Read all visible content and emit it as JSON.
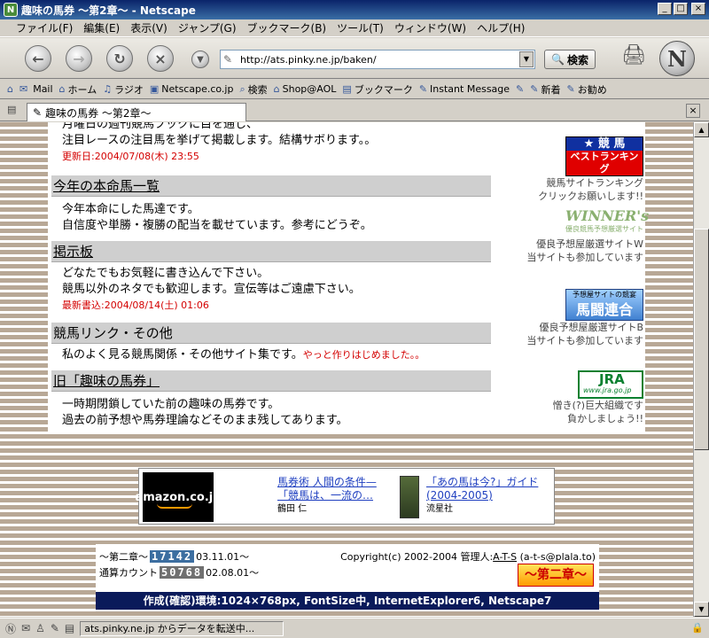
{
  "window": {
    "title": "趣味の馬券 〜第2章〜 - Netscape",
    "min": "_",
    "max": "□",
    "close": "×"
  },
  "menu": [
    "ファイル(F)",
    "編集(E)",
    "表示(V)",
    "ジャンプ(G)",
    "ブックマーク(B)",
    "ツール(T)",
    "ウィンドウ(W)",
    "ヘルプ(H)"
  ],
  "nav": {
    "url": "http://ats.pinky.ne.jp/baken/",
    "search_label": "検索"
  },
  "bookmarks": [
    {
      "label": "Mail",
      "icon": "mail-icon"
    },
    {
      "label": "ホーム",
      "icon": "home-icon"
    },
    {
      "label": "ラジオ",
      "icon": "headphones-icon"
    },
    {
      "label": "Netscape.co.jp",
      "icon": "my-icon"
    },
    {
      "label": "検索",
      "icon": "search-icon"
    },
    {
      "label": "Shop@AOL",
      "icon": "shop-icon"
    },
    {
      "label": "ブックマーク",
      "icon": "folder-icon"
    },
    {
      "label": "Instant Message",
      "icon": "bookmark-icon"
    },
    {
      "label": "新着",
      "icon": "bookmark-icon"
    },
    {
      "label": "お勧め",
      "icon": "bookmark-icon"
    }
  ],
  "tab": {
    "label": "趣味の馬券 〜第2章〜"
  },
  "content": {
    "top": {
      "line1": "月曜日の週刊競馬ブックに目を通し、",
      "line2": "注目レースの注目馬を挙げて掲載します。結構サボります。。",
      "updated": "更新日:2004/07/08(木) 23:55"
    },
    "sections": [
      {
        "heading": "今年の本命馬一覧",
        "line1": "今年本命にした馬達です。",
        "line2": "自信度や単勝・複勝の配当を載せています。参考にどうぞ。"
      },
      {
        "heading": "掲示板",
        "line1": "どなたでもお気軽に書き込んで下さい。",
        "line2": "競馬以外のネタでも歓迎します。宣伝等はご遠慮下さい。",
        "extra": "最新書込:2004/08/14(土) 01:06"
      },
      {
        "heading": "競馬リンク・その他",
        "line1": "私のよく見る競馬関係・その他サイト集です。",
        "note": "やっと作りはじめました。。"
      },
      {
        "heading": "旧「趣味の馬券」",
        "line1": "一時期閉鎖していた前の趣味の馬券です。",
        "line2": "過去の前予想や馬券理論などそのまま残してあります。"
      }
    ],
    "sidebar": [
      {
        "banner_top": "★ 競 馬",
        "banner_bottom": "ベストランキング",
        "text1": "競馬サイトランキング",
        "text2": "クリックお願いします!!"
      },
      {
        "banner_top": "WINNER's",
        "banner_bottom": "優良競馬予想厳選サイト",
        "text1": "優良予想屋厳選サイトW",
        "text2": "当サイトも参加しています"
      },
      {
        "banner_top": "予想屋サイトの競宴",
        "banner_bottom": "馬闘連合",
        "text1": "優良予想屋厳選サイトB",
        "text2": "当サイトも参加しています"
      },
      {
        "banner_top": "JRA",
        "banner_bottom": "www.jra.go.jp",
        "text1": "憎き(?)巨大組織です",
        "text2": "負かしましょう!!"
      }
    ],
    "amazon": {
      "logo": "amazon.co.jp",
      "item1_title1": "馬券術 人間の条件—",
      "item1_title2": "「競馬は、一流の…",
      "item1_author": "鶴田 仁",
      "item2_title1": "「あの馬は今?」ガイド",
      "item2_title2": "(2004-2005)",
      "item2_author": "流星社"
    },
    "footer": {
      "counter1_label": "〜第二章〜",
      "counter1_digits": "17142",
      "counter1_date": "03.11.01〜",
      "counter2_label": "通算カウント",
      "counter2_digits": "50768",
      "counter2_date": "02.08.01〜",
      "copyright": "Copyright(c) 2002-2004 管理人:",
      "admin": "A-T-S",
      "email": "(a-t-s@plala.to)",
      "logo": "〜第二章〜",
      "env": "作成(確認)環境:1024×768px, FontSize中, InternetExplorer6, Netscape7"
    }
  },
  "status": {
    "text": "ats.pinky.ne.jp からデータを転送中..."
  }
}
